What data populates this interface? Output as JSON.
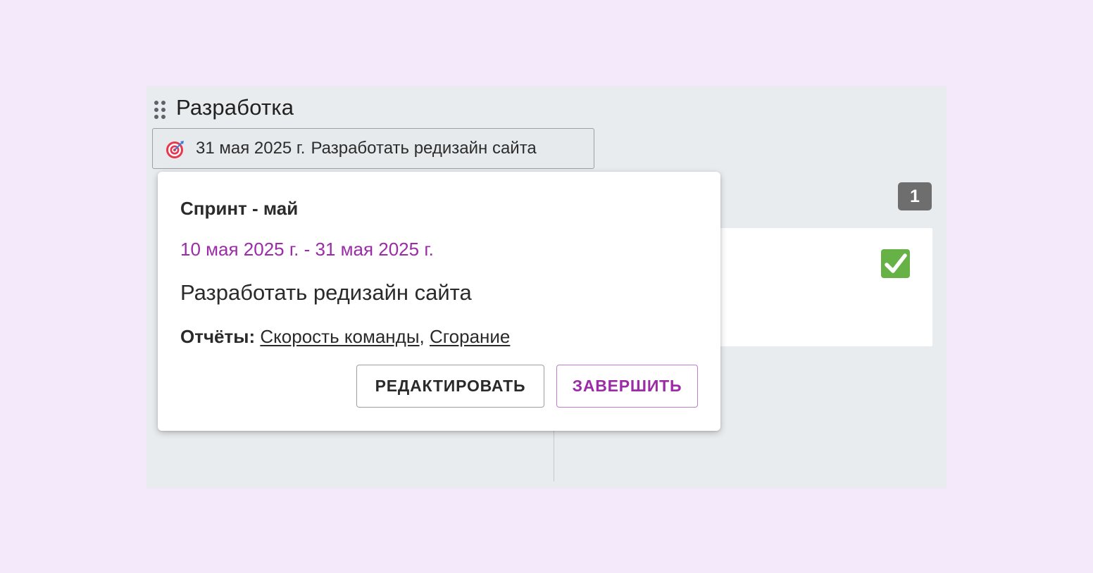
{
  "board": {
    "title": "Разработка",
    "sprint_chip": {
      "date": "31 мая 2025 г.",
      "goal": "Разработать редизайн сайта",
      "icon": "target-icon"
    },
    "column_count": "1",
    "task_card": {
      "status_icon": "check-mark-icon",
      "status_color": "#67b246"
    }
  },
  "popover": {
    "sprint_name": "Спринт - май",
    "dates": "10 мая 2025 г. - 31 мая 2025 г.",
    "goal": "Разработать редизайн сайта",
    "reports_label": "Отчёты:",
    "reports": [
      {
        "label": "Скорость команды"
      },
      {
        "label": "Сгорание"
      }
    ],
    "edit_label": "РЕДАКТИРОВАТЬ",
    "finish_label": "ЗАВЕРШИТЬ"
  },
  "colors": {
    "accent": "#9c2ba8",
    "background": "#f4e9fb",
    "board": "#e9ecee"
  }
}
